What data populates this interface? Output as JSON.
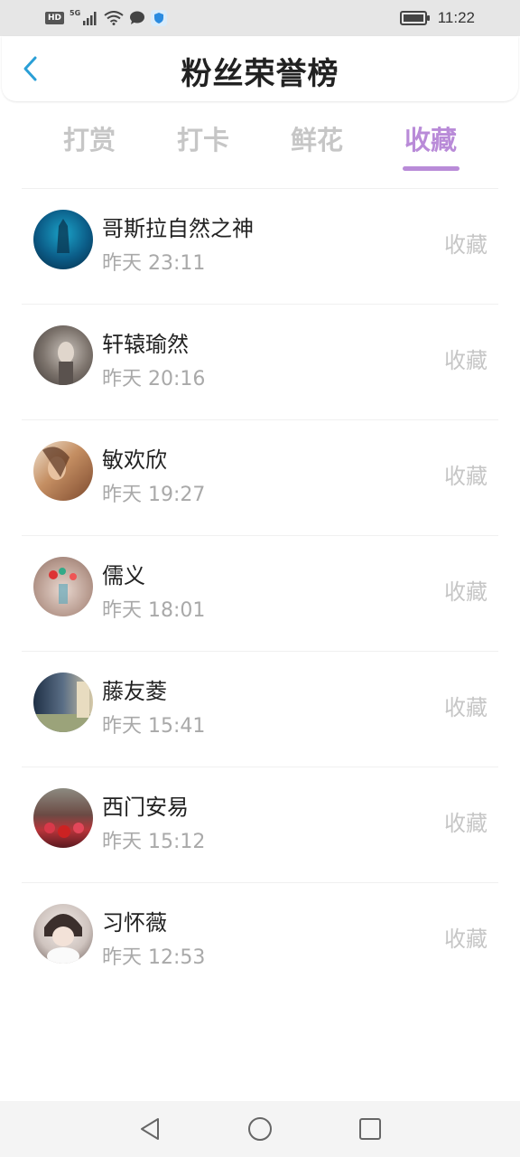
{
  "status_bar": {
    "hd": "HD",
    "network": "5G",
    "time": "11:22"
  },
  "header": {
    "title": "粉丝荣誉榜"
  },
  "tabs": [
    {
      "label": "打赏"
    },
    {
      "label": "打卡"
    },
    {
      "label": "鲜花"
    },
    {
      "label": "收藏"
    }
  ],
  "active_tab": "收藏",
  "rows": [
    {
      "name": "哥斯拉自然之神",
      "time": "昨天 23:11",
      "action": "收藏"
    },
    {
      "name": "轩辕瑜然",
      "time": "昨天 20:16",
      "action": "收藏"
    },
    {
      "name": "敏欢欣",
      "time": "昨天 19:27",
      "action": "收藏"
    },
    {
      "name": "儒义",
      "time": "昨天 18:01",
      "action": "收藏"
    },
    {
      "name": "藤友菱",
      "time": "昨天 15:41",
      "action": "收藏"
    },
    {
      "name": "西门安易",
      "time": "昨天 15:12",
      "action": "收藏"
    },
    {
      "name": "习怀薇",
      "time": "昨天 12:53",
      "action": "收藏"
    }
  ],
  "colors": {
    "accent": "#b98bd8",
    "back_arrow": "#2a9fd6",
    "muted": "#c6c6c6"
  }
}
